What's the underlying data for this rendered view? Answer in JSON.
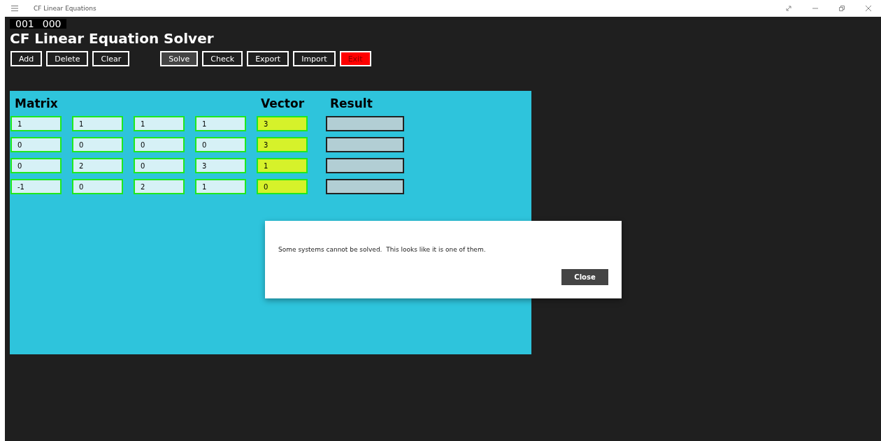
{
  "window": {
    "title": "CF Linear Equations"
  },
  "counters": [
    "001",
    "000"
  ],
  "app_title": "CF Linear Equation Solver",
  "toolbar_groups": [
    [
      {
        "label": "Add",
        "kind": "normal"
      },
      {
        "label": "Delete",
        "kind": "normal"
      },
      {
        "label": "Clear",
        "kind": "normal"
      }
    ],
    [
      {
        "label": "Solve",
        "kind": "active"
      },
      {
        "label": "Check",
        "kind": "normal"
      },
      {
        "label": "Export",
        "kind": "normal"
      },
      {
        "label": "Import",
        "kind": "normal"
      },
      {
        "label": "Exit",
        "kind": "danger"
      }
    ]
  ],
  "panel": {
    "matrix_heading": "Matrix",
    "vector_heading": "Vector",
    "result_heading": "Result",
    "rows": [
      {
        "matrix": [
          "1",
          "1",
          "1",
          "1"
        ],
        "vector": "3"
      },
      {
        "matrix": [
          "0",
          "0",
          "0",
          "0"
        ],
        "vector": "3"
      },
      {
        "matrix": [
          "0",
          "2",
          "0",
          "3"
        ],
        "vector": "1"
      },
      {
        "matrix": [
          "-1",
          "0",
          "2",
          "1"
        ],
        "vector": "0"
      }
    ]
  },
  "dialog": {
    "message": "Some systems cannot be solved.  This looks like it is one of them.",
    "button": "Close"
  }
}
